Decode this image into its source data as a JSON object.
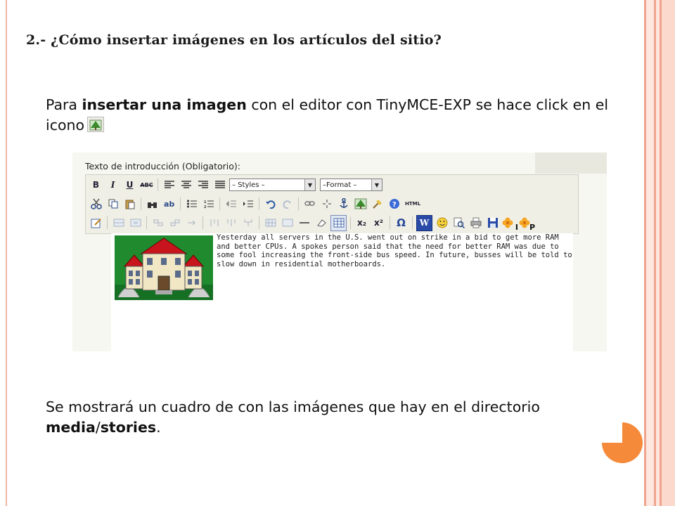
{
  "slide": {
    "title": "2.- ¿Cómo insertar imágenes en los artículos del sitio?",
    "para1": {
      "pre": "Para ",
      "bold": "insertar una imagen",
      "post": " con el editor con TinyMCE-EXP se hace click en el icono"
    },
    "para2": {
      "pre": "Se mostrará un cuadro de con las imágenes que hay en el directorio ",
      "bold1": "media",
      "slash": "/",
      "bold2": "stories",
      "end": "."
    }
  },
  "editor": {
    "field_label": "Texto de introducción (Obligatorio):",
    "styles_select": "– Styles –",
    "format_select": "–Format –",
    "html_label": "HTML",
    "content": "Yesterday all servers in the U.S. went out on strike in a bid to get more RAM and better CPUs. A spokes person said that the need for better RAM was due to some fool increasing the front-side bus speed. In future, busses will be told to slow down in residential motherboards.",
    "toolbar": {
      "bold": "B",
      "italic": "I",
      "underline": "U",
      "strike": "ABC",
      "subscript": "x₂",
      "superscript": "x²",
      "omega": "Ω",
      "word": "W",
      "plugin_i": "I",
      "plugin_p": "P"
    }
  },
  "colors": {
    "accent_orange": "#f58a3a",
    "border_salmon": "#f0a48d"
  }
}
